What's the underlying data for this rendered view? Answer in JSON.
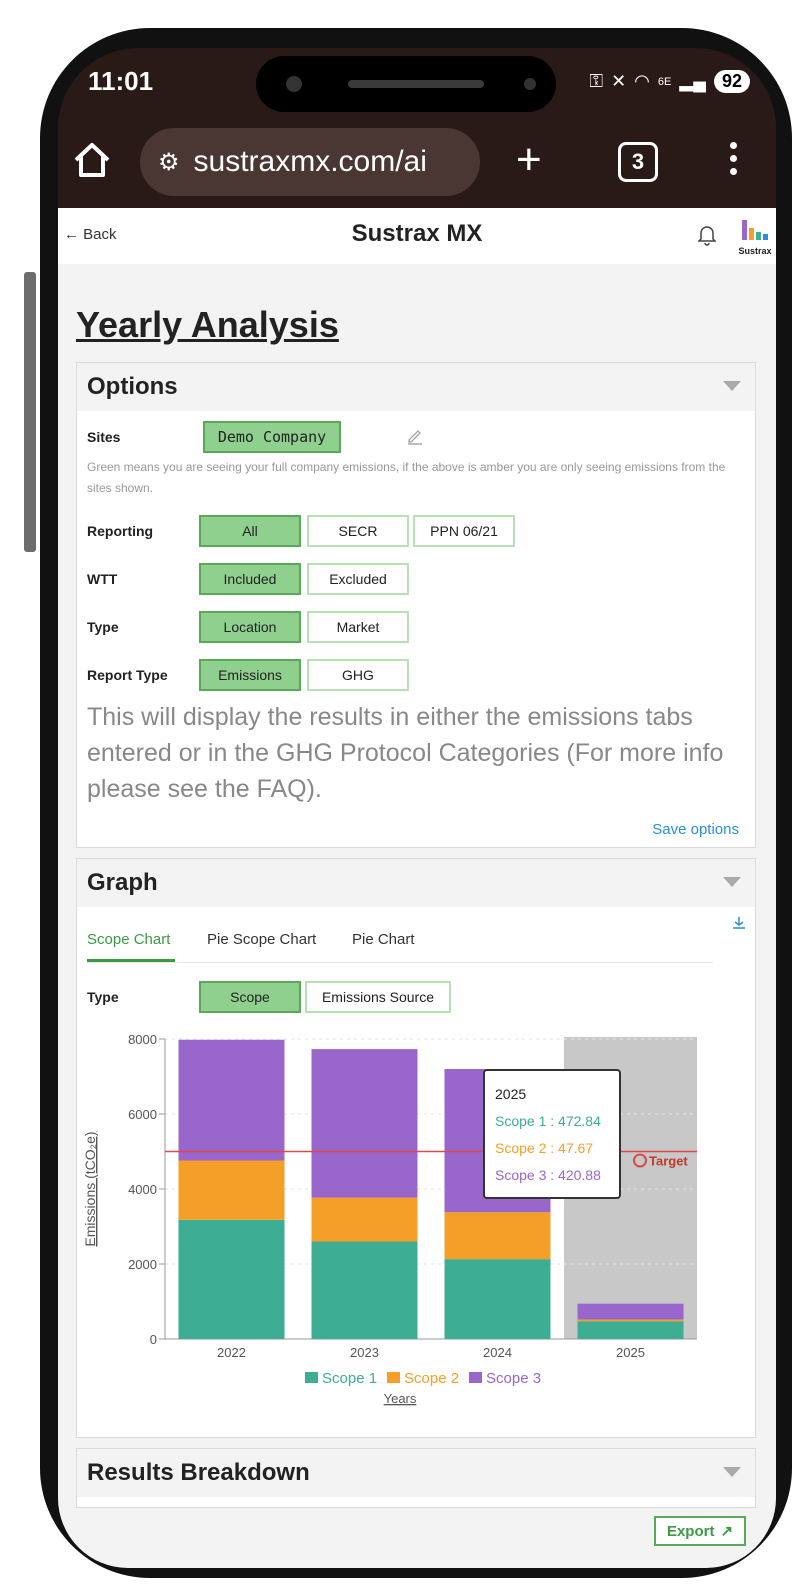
{
  "status_bar": {
    "time": "11:01",
    "battery": "92",
    "network": "6E"
  },
  "browser": {
    "url": "sustraxmx.com/ai",
    "tab_count": "3",
    "plus": "+"
  },
  "app_bar": {
    "back": "← Back",
    "title": "Sustrax MX",
    "logo_text": "Sustrax"
  },
  "page": {
    "title": "Yearly Analysis"
  },
  "options": {
    "heading": "Options",
    "sites_label": "Sites",
    "site_value": "Demo Company",
    "hint": "Green means you are seeing your full company emissions, if the above is amber you are only seeing emissions from the sites shown.",
    "reporting_label": "Reporting",
    "reporting": [
      "All",
      "SECR",
      "PPN 06/21"
    ],
    "wtt_label": "WTT",
    "wtt": [
      "Included",
      "Excluded"
    ],
    "type_label": "Type",
    "type": [
      "Location",
      "Market"
    ],
    "report_type_label": "Report Type",
    "report_type": [
      "Emissions",
      "GHG"
    ],
    "description": "This will display the results in either the emissions tabs entered or in the GHG Protocol Categories (For more info please see the FAQ).",
    "save": "Save options"
  },
  "graph": {
    "heading": "Graph",
    "tabs": [
      "Scope Chart",
      "Pie Scope Chart",
      "Pie Chart"
    ],
    "type_label": "Type",
    "type_options": [
      "Scope",
      "Emissions Source"
    ],
    "target_label": "Target",
    "tooltip": {
      "year": "2025",
      "s1": "Scope 1 : 472.84",
      "s2": "Scope 2 : 47.67",
      "s3": "Scope 3 : 420.88"
    }
  },
  "results": {
    "heading": "Results Breakdown",
    "export": "Export"
  },
  "colors": {
    "scope1": "#3dae93",
    "scope2": "#f59f29",
    "scope3": "#9966cc",
    "accent_green": "#3c9a45",
    "target_line": "#d94a4a"
  },
  "chart_data": {
    "type": "bar",
    "stacked": true,
    "categories": [
      "2022",
      "2023",
      "2024",
      "2025"
    ],
    "series": [
      {
        "name": "Scope 1",
        "values": [
          3180,
          2600,
          2130,
          472.84
        ]
      },
      {
        "name": "Scope 2",
        "values": [
          1580,
          1170,
          1250,
          47.67
        ]
      },
      {
        "name": "Scope 3",
        "values": [
          3220,
          3960,
          3820,
          420.88
        ]
      }
    ],
    "target": 5000,
    "highlight_category": "2025",
    "xlabel": "Years",
    "ylabel": "Emissions (tCO₂e)",
    "ylim": [
      0,
      8000
    ],
    "yticks": [
      0,
      2000,
      4000,
      6000,
      8000
    ],
    "grid": true,
    "legend": "bottom"
  }
}
